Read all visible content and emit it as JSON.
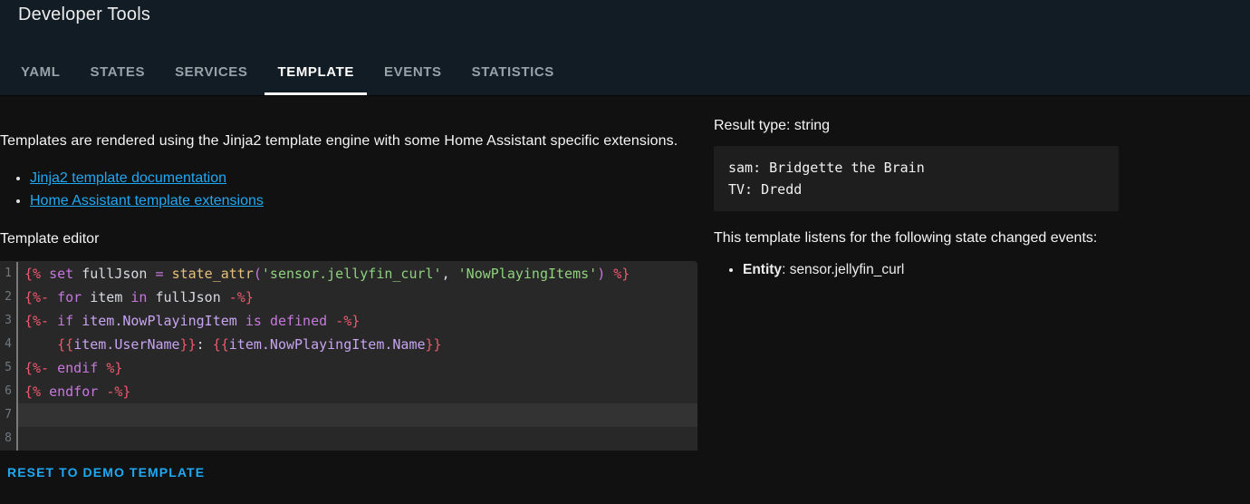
{
  "header": {
    "title": "Developer Tools"
  },
  "tabs": [
    {
      "label": "YAML",
      "active": false
    },
    {
      "label": "STATES",
      "active": false
    },
    {
      "label": "SERVICES",
      "active": false
    },
    {
      "label": "TEMPLATE",
      "active": true
    },
    {
      "label": "EVENTS",
      "active": false
    },
    {
      "label": "STATISTICS",
      "active": false
    }
  ],
  "intro": {
    "text": "Templates are rendered using the Jinja2 template engine with some Home Assistant specific extensions.",
    "links": [
      "Jinja2 template documentation",
      "Home Assistant template extensions"
    ]
  },
  "editor": {
    "label": "Template editor",
    "active_line": 7,
    "lines": [
      {
        "num": 1,
        "tokens": [
          [
            "{%",
            "tag"
          ],
          [
            " ",
            "pl"
          ],
          [
            "set",
            "kw"
          ],
          [
            " ",
            "pl"
          ],
          [
            "fullJson",
            "name"
          ],
          [
            " ",
            "pl"
          ],
          [
            "=",
            "kw"
          ],
          [
            " ",
            "pl"
          ],
          [
            "state_attr",
            "fn"
          ],
          [
            "(",
            "kw"
          ],
          [
            "'sensor.jellyfin_curl'",
            "str"
          ],
          [
            ", ",
            "name"
          ],
          [
            "'NowPlayingItems'",
            "str"
          ],
          [
            ")",
            "kw"
          ],
          [
            " ",
            "pl"
          ],
          [
            "%}",
            "tag"
          ]
        ]
      },
      {
        "num": 2,
        "tokens": [
          [
            "{%-",
            "tag"
          ],
          [
            " ",
            "pl"
          ],
          [
            "for",
            "kw"
          ],
          [
            " ",
            "pl"
          ],
          [
            "item",
            "name"
          ],
          [
            " ",
            "pl"
          ],
          [
            "in",
            "kw"
          ],
          [
            " ",
            "pl"
          ],
          [
            "fullJson",
            "name"
          ],
          [
            " ",
            "pl"
          ],
          [
            "-%}",
            "tag"
          ]
        ]
      },
      {
        "num": 3,
        "tokens": [
          [
            "{%-",
            "tag"
          ],
          [
            " ",
            "pl"
          ],
          [
            "if",
            "kw"
          ],
          [
            " ",
            "pl"
          ],
          [
            "item.NowPlayingItem",
            "var"
          ],
          [
            " ",
            "pl"
          ],
          [
            "is",
            "kw"
          ],
          [
            " ",
            "pl"
          ],
          [
            "defined",
            "kw"
          ],
          [
            " ",
            "pl"
          ],
          [
            "-%}",
            "tag"
          ]
        ]
      },
      {
        "num": 4,
        "tokens": [
          [
            "    ",
            "pl"
          ],
          [
            "{{",
            "tag"
          ],
          [
            "item.UserName",
            "var"
          ],
          [
            "}}",
            "tag"
          ],
          [
            ":",
            "name"
          ],
          [
            " ",
            "pl"
          ],
          [
            "{{",
            "tag"
          ],
          [
            "item.NowPlayingItem.Name",
            "var"
          ],
          [
            "}}",
            "tag"
          ]
        ]
      },
      {
        "num": 5,
        "tokens": [
          [
            "{%-",
            "tag"
          ],
          [
            " ",
            "pl"
          ],
          [
            "endif",
            "kw"
          ],
          [
            " ",
            "pl"
          ],
          [
            "%}",
            "tag"
          ]
        ]
      },
      {
        "num": 6,
        "tokens": [
          [
            "{%",
            "tag"
          ],
          [
            " ",
            "pl"
          ],
          [
            "endfor",
            "kw"
          ],
          [
            " ",
            "pl"
          ],
          [
            "-%}",
            "tag"
          ]
        ]
      },
      {
        "num": 7,
        "tokens": []
      },
      {
        "num": 8,
        "tokens": []
      }
    ]
  },
  "actions": {
    "reset_label": "RESET TO DEMO TEMPLATE"
  },
  "result": {
    "type_label": "Result type: string",
    "output": "sam: Bridgette the Brain\nTV: Dredd",
    "listeners_heading": "This template listens for the following state changed events:",
    "listeners": [
      {
        "label": "Entity",
        "value": "sensor.jellyfin_curl"
      }
    ]
  },
  "colors": {
    "accent_link_blue": "#1fa9f4",
    "header_background": "#121c24",
    "page_background": "#111111",
    "editor_background": "#282828",
    "editor_active_line": "#333333",
    "result_box_background": "#1e1e1e",
    "code_tag_red": "#ef596f",
    "code_keyword_purple": "#c678dd",
    "code_variable_lavender": "#c7a4f2",
    "code_function_yellow": "#e5c07b",
    "code_string_green": "#8fd17e"
  }
}
